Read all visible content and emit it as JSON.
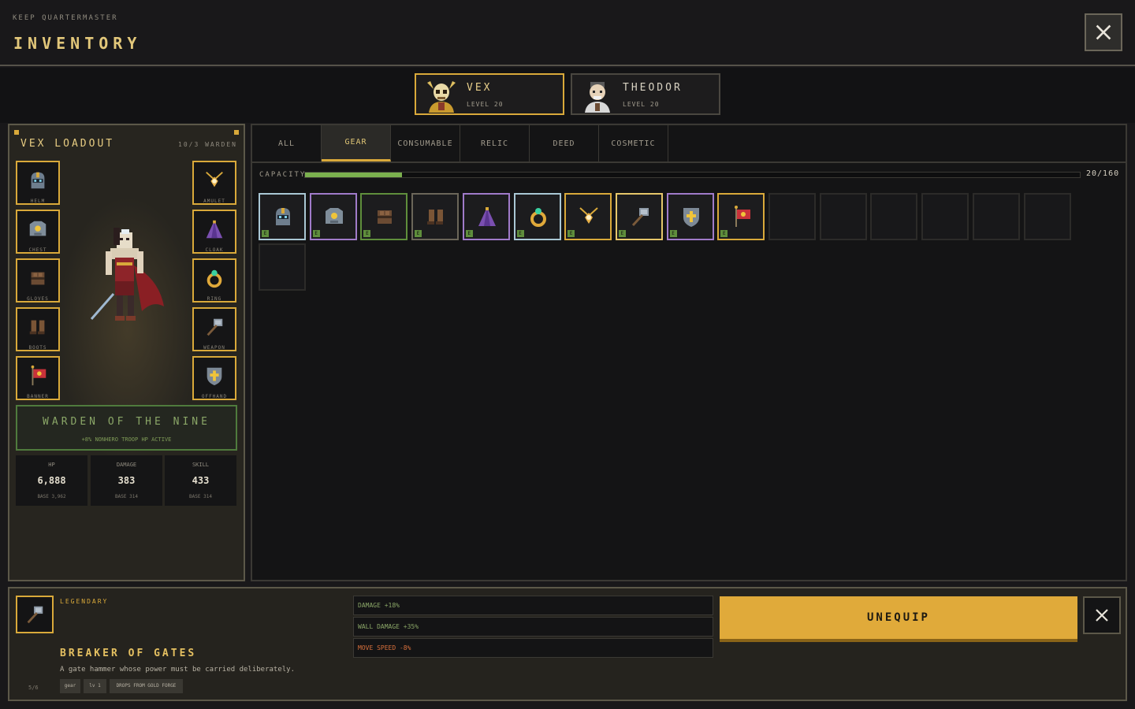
{
  "header": {
    "eyebrow": "KEEP QUARTERMASTER",
    "title": "INVENTORY"
  },
  "heroes": [
    {
      "name": "VEX",
      "level": "LEVEL 20",
      "active": true
    },
    {
      "name": "THEODOR",
      "level": "LEVEL 20",
      "active": false
    }
  ],
  "loadout": {
    "title": "VEX LOADOUT",
    "count": "10/3 WARDEN",
    "left_slots": [
      {
        "label": "HELM",
        "icon": "helm-icon"
      },
      {
        "label": "CHEST",
        "icon": "chest-icon"
      },
      {
        "label": "GLOVES",
        "icon": "gloves-icon"
      },
      {
        "label": "BOOTS",
        "icon": "boots-icon"
      },
      {
        "label": "BANNER",
        "icon": "banner-icon"
      }
    ],
    "right_slots": [
      {
        "label": "AMULET",
        "icon": "amulet-icon"
      },
      {
        "label": "CLOAK",
        "icon": "cloak-icon"
      },
      {
        "label": "RING",
        "icon": "ring-icon"
      },
      {
        "label": "WEAPON",
        "icon": "hammer-icon"
      },
      {
        "label": "OFFHAND",
        "icon": "shield-icon"
      }
    ],
    "set_name": "WARDEN OF THE NINE",
    "set_bonus": "+8% NONHERO TROOP HP ACTIVE",
    "stats": [
      {
        "label": "HP",
        "value": "6,888",
        "base": "BASE 3,962"
      },
      {
        "label": "DAMAGE",
        "value": "383",
        "base": "BASE 314"
      },
      {
        "label": "SKILL",
        "value": "433",
        "base": "BASE 314"
      }
    ]
  },
  "tabs": [
    "ALL",
    "GEAR",
    "CONSUMABLE",
    "RELIC",
    "DEED",
    "COSMETIC"
  ],
  "active_tab": "GEAR",
  "capacity": {
    "label": "CAPACITY",
    "value": "20/160",
    "fraction": 0.125
  },
  "grid_items": [
    {
      "icon": "helm-icon",
      "border": "#a9c7d4",
      "equipped": "E"
    },
    {
      "icon": "chest-icon",
      "border": "#a07bc9",
      "equipped": "E"
    },
    {
      "icon": "gloves-icon",
      "border": "#5f8e3c",
      "equipped": "E"
    },
    {
      "icon": "boots-icon",
      "border": "#6b6659",
      "equipped": "E"
    },
    {
      "icon": "cloak-icon",
      "border": "#a07bc9",
      "equipped": "E"
    },
    {
      "icon": "ring-icon",
      "border": "#a9c7d4",
      "equipped": "E"
    },
    {
      "icon": "amulet-icon",
      "border": "#d9a93a",
      "equipped": "E"
    },
    {
      "icon": "hammer-icon",
      "border": "#e6c66a",
      "equipped": "E"
    },
    {
      "icon": "shield-icon",
      "border": "#a07bc9",
      "equipped": "E"
    },
    {
      "icon": "banner-icon",
      "border": "#d9a93a",
      "equipped": "E"
    }
  ],
  "detail": {
    "rarity": "LEGENDARY",
    "name": "BREAKER OF GATES",
    "description": "A gate hammer whose power must be carried deliberately.",
    "count": "5/6",
    "tags": [
      "gear",
      "lv 1",
      "DROPS FROM GOLD FORGE"
    ],
    "mods": [
      {
        "text": "DAMAGE +18%",
        "color": "#8aa667"
      },
      {
        "text": "WALL DAMAGE +35%",
        "color": "#8aa667"
      },
      {
        "text": "MOVE SPEED -8%",
        "color": "#d8703c"
      }
    ],
    "unequip_label": "UNEQUIP"
  },
  "colors": {
    "accent": "#d9a93a",
    "equipped": "#5f8e3c",
    "capacity": "#7bb04e"
  }
}
